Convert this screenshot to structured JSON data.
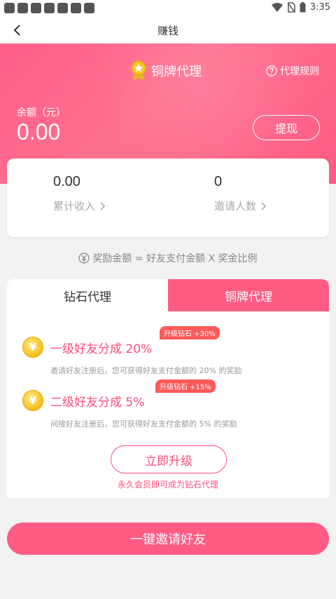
{
  "status_bar": {
    "time": "3:35"
  },
  "nav": {
    "title": "赚钱"
  },
  "hero": {
    "level_title": "铜牌代理",
    "rules_label": "代理规则",
    "balance_label": "余额（元）",
    "balance_value": "0.00",
    "withdraw_label": "提现"
  },
  "stats": {
    "income_value": "0.00",
    "income_label": "累计收入",
    "invite_value": "0",
    "invite_label": "邀请人数"
  },
  "formula": "奖励金额 = 好友支付金额 X 奖金比例",
  "tabs": [
    {
      "label": "钻石代理"
    },
    {
      "label": "铜牌代理"
    }
  ],
  "tiers": [
    {
      "title": "一级好友分成 20%",
      "tag": "升级钻石 +30%",
      "desc": "邀请好友注册后，您可获得好友支付金额的 20% 的奖励"
    },
    {
      "title": "二级好友分成  5%",
      "tag": "升级钻石 +15%",
      "desc": "间接好友注册后，您可获得好友支付金额的  5% 的奖励"
    }
  ],
  "upgrade": {
    "button_label": "立即升级",
    "note": "永久会员即可成为钻石代理"
  },
  "invite_button_label": "一键邀请好友",
  "colors": {
    "accent": "#ff5c84",
    "accent_text": "#ff4f78",
    "tag": "#ff5a5a",
    "coin": "#f7c52a"
  }
}
